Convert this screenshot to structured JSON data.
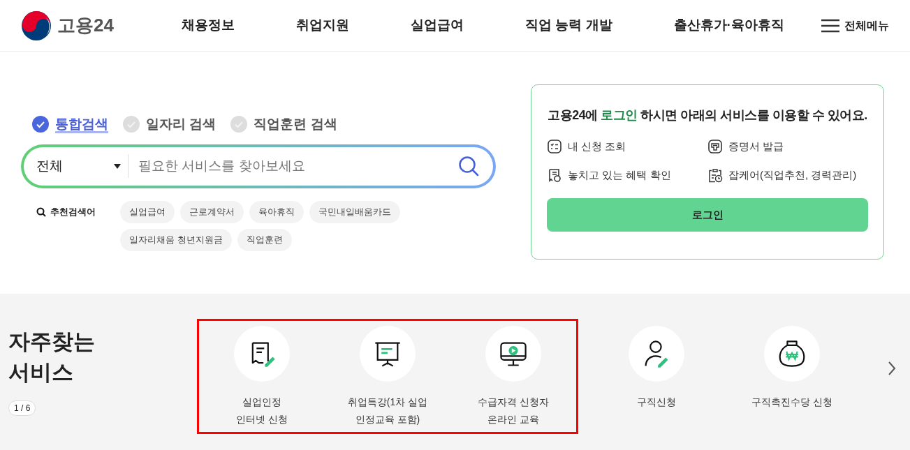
{
  "header": {
    "logo_text": "고용24",
    "nav": [
      "채용정보",
      "취업지원",
      "실업급여",
      "직업 능력 개발",
      "출산휴가·육아휴직"
    ],
    "all_menu": "전체메뉴"
  },
  "search": {
    "tabs": [
      {
        "label": "통합검색",
        "selected": true
      },
      {
        "label": "일자리 검색",
        "selected": false
      },
      {
        "label": "직업훈련 검색",
        "selected": false
      }
    ],
    "category": "전체",
    "placeholder": "필요한 서비스를 찾아보세요",
    "recommended_label": "추천검색어",
    "keywords": [
      "실업급여",
      "근로계약서",
      "육아휴직",
      "국민내일배움카드",
      "일자리채움 청년지원금",
      "직업훈련"
    ]
  },
  "login_card": {
    "message": "고용24에 **로그인** 하시면 아래의 서비스를 이용할 수 있어요.",
    "services": [
      {
        "kind": "list",
        "label": "내 신청 조회"
      },
      {
        "kind": "certificate",
        "label": "증명서 발급"
      },
      {
        "kind": "receipt",
        "label": "놓치고 있는 혜택 확인"
      },
      {
        "kind": "clipboard",
        "label": "잡케어(직업추천, 경력관리)"
      }
    ],
    "button": "로그인"
  },
  "frequent": {
    "title": "자주찾는\n서비스",
    "pager": "1 / 6",
    "items": [
      {
        "kind": "form",
        "label": "실업인정\n인터넷 신청",
        "highlighted": true
      },
      {
        "kind": "presentation",
        "label": "취업특강(1차 실업\n인정교육 포함)",
        "highlighted": true
      },
      {
        "kind": "video",
        "label": "수급자격 신청자\n온라인 교육",
        "highlighted": true
      },
      {
        "kind": "person",
        "label": "구직신청",
        "highlighted": false
      },
      {
        "kind": "moneybag",
        "label": "구직촉진수당 신청",
        "highlighted": false
      }
    ]
  }
}
